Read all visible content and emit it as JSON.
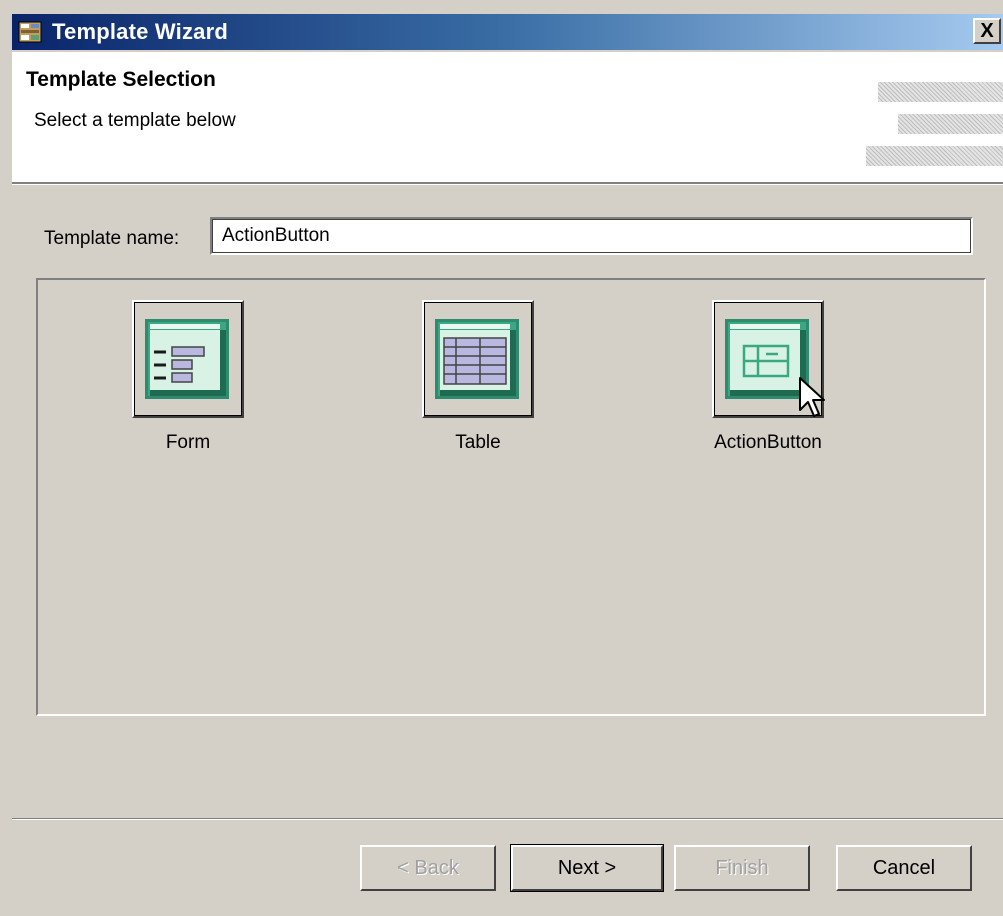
{
  "window": {
    "title": "Template Wizard",
    "close_glyph": "X",
    "icon": "wizard-icon"
  },
  "header": {
    "title": "Template Selection",
    "subtitle": "Select a template below"
  },
  "template_name": {
    "label": "Template name:",
    "value": "ActionButton"
  },
  "templates": [
    {
      "label": "Form",
      "icon": "form-template-icon"
    },
    {
      "label": "Table",
      "icon": "table-template-icon"
    },
    {
      "label": "ActionButton",
      "icon": "actionbutton-template-icon"
    }
  ],
  "buttons": {
    "back": "< Back",
    "next": "Next >",
    "finish": "Finish",
    "cancel": "Cancel"
  },
  "colors": {
    "titlebar_start": "#0a246a",
    "titlebar_end": "#a6caf0",
    "template_green": "#2e8b6e",
    "template_light": "#d9f2e6"
  }
}
